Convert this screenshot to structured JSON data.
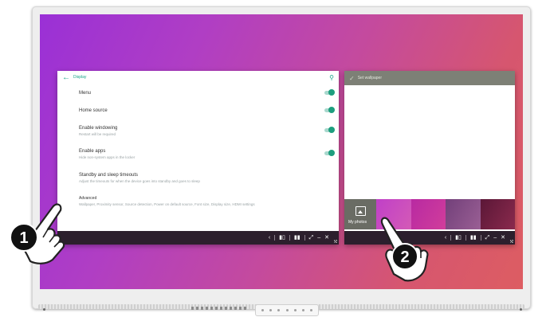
{
  "display_window": {
    "title": "Display",
    "items": [
      {
        "label": "Menu",
        "sub": "",
        "toggle": true
      },
      {
        "label": "Home source",
        "sub": "",
        "toggle": true
      },
      {
        "label": "Enable windowing",
        "sub": "Restart will be required",
        "toggle": true
      },
      {
        "label": "Enable apps",
        "sub": "Hide non-system apps in the locker",
        "toggle": true
      },
      {
        "label": "Standby and sleep timeouts",
        "sub": "Adjust the timeouts for when the device goes into standby and goes to sleep",
        "toggle": false
      },
      {
        "label": "Advanced",
        "sub": "Wallpaper, Proximity sensor, Source detection, Power on default source, Font size, Display size, HDMI settings",
        "toggle": false
      }
    ]
  },
  "wallpaper_window": {
    "title": "Set wallpaper",
    "my_photos_label": "My photos"
  },
  "taskbar": {
    "back": "‹",
    "split": "▮▯",
    "columns": "▮▮",
    "expand": "⤢",
    "minimize": "–",
    "close": "✕"
  },
  "callouts": [
    "1",
    "2"
  ],
  "colors": {
    "accent": "#17a589",
    "taskbar": "#2c1f2d",
    "wallpaper_header": "#7d8076"
  }
}
